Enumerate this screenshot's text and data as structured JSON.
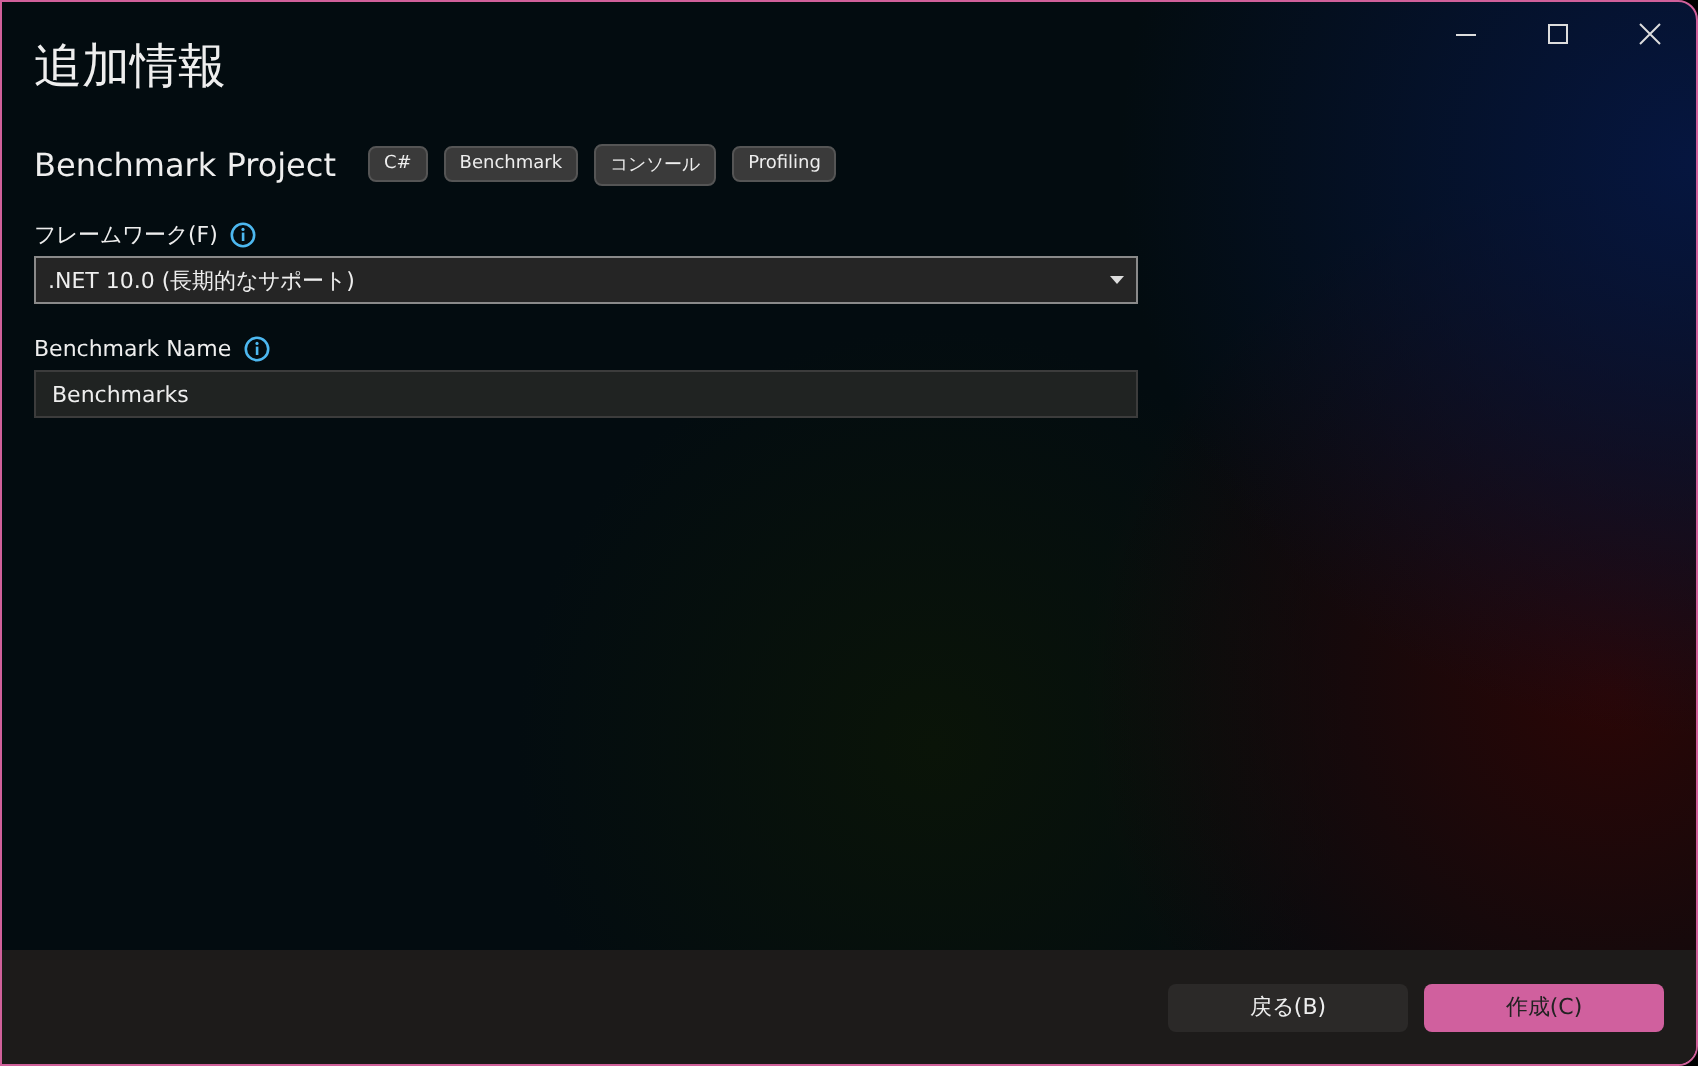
{
  "window": {
    "title": "追加情報"
  },
  "project": {
    "name": "Benchmark Project",
    "tags": [
      "C#",
      "Benchmark",
      "コンソール",
      "Profiling"
    ]
  },
  "fields": [
    {
      "kind": "dropdown",
      "label": "フレームワーク(F)",
      "value": ".NET 10.0 (長期的なサポート)"
    },
    {
      "kind": "text",
      "label": "Benchmark Name",
      "value": "Benchmarks"
    }
  ],
  "buttons": [
    {
      "label": "戻る(B)",
      "primary": false
    },
    {
      "label": "作成(C)",
      "primary": true
    }
  ]
}
